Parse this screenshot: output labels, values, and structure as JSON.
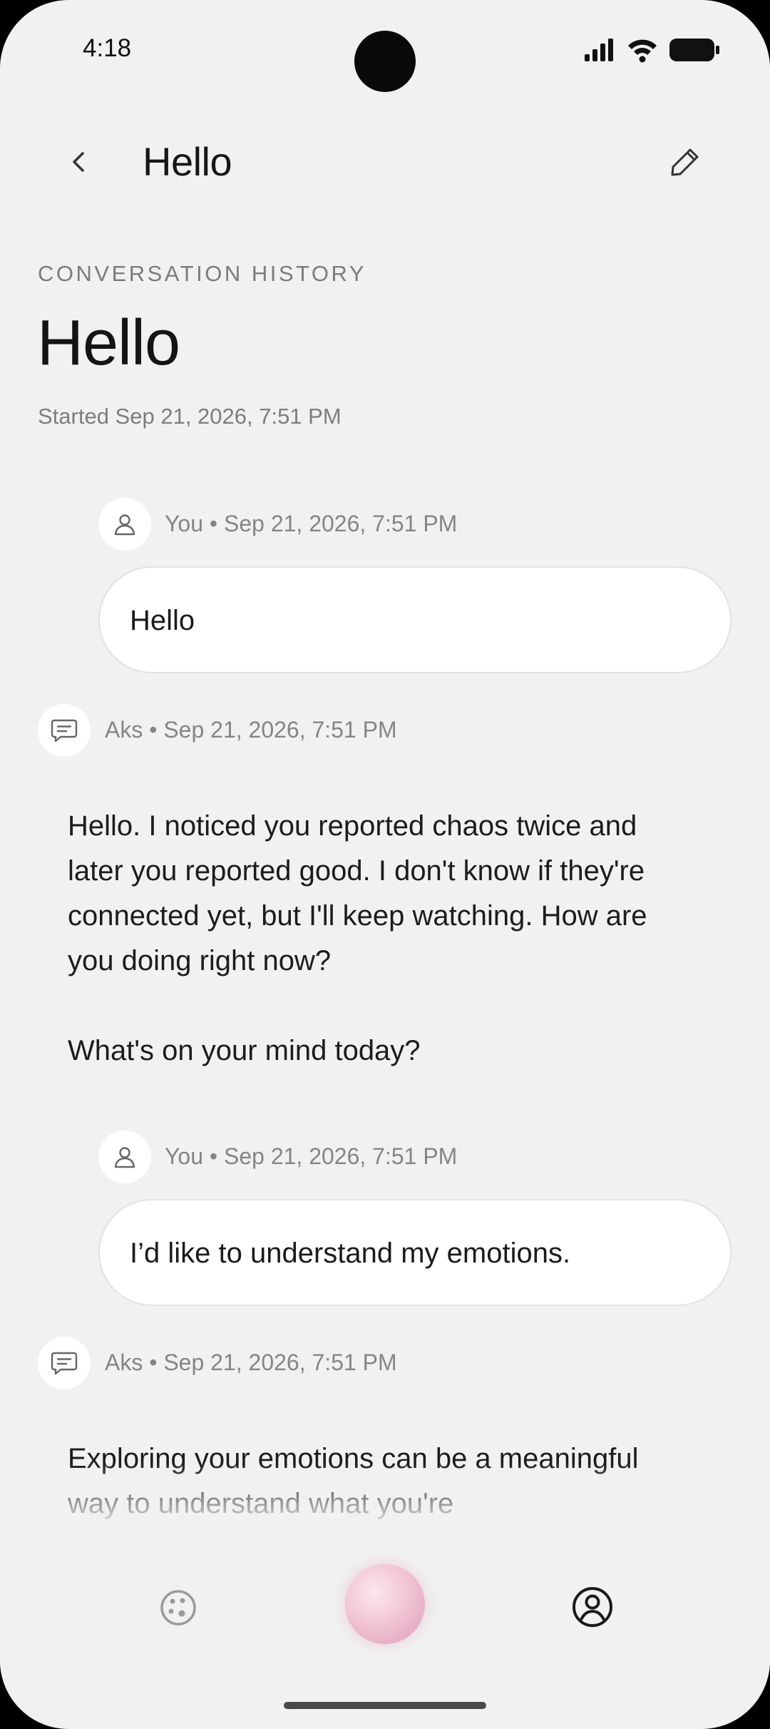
{
  "status_bar": {
    "time": "4:18"
  },
  "app_bar": {
    "title": "Hello"
  },
  "header": {
    "section_label": "CONVERSATION HISTORY",
    "title": "Hello",
    "started": "Started Sep 21, 2026, 7:51 PM"
  },
  "messages": [
    {
      "role": "user",
      "meta": "You • Sep 21, 2026, 7:51 PM",
      "text": "Hello"
    },
    {
      "role": "assistant",
      "meta": "Aks • Sep 21, 2026, 7:51 PM",
      "paragraphs": [
        "Hello. I noticed you reported chaos twice and later you reported good. I don't know if they're connected yet, but I'll keep watching. How are you doing right now?",
        "What's on your mind today?"
      ]
    },
    {
      "role": "user",
      "meta": "You • Sep 21, 2026, 7:51 PM",
      "text": "I’d like to understand my emotions."
    },
    {
      "role": "assistant",
      "meta": "Aks • Sep 21, 2026, 7:51 PM",
      "paragraphs": [
        "Exploring your emotions can be a meaningful way to understand what you're"
      ]
    }
  ],
  "icons": {
    "back": "chevron-left-icon",
    "edit": "pencil-icon",
    "user_avatar": "person-icon",
    "assistant_avatar": "chat-bubble-icon",
    "nav_explore": "palette-icon",
    "nav_center": "orb",
    "nav_profile": "profile-circle-icon"
  },
  "colors": {
    "background": "#f1f1f1",
    "orb_accent": "#e9b2c8"
  }
}
